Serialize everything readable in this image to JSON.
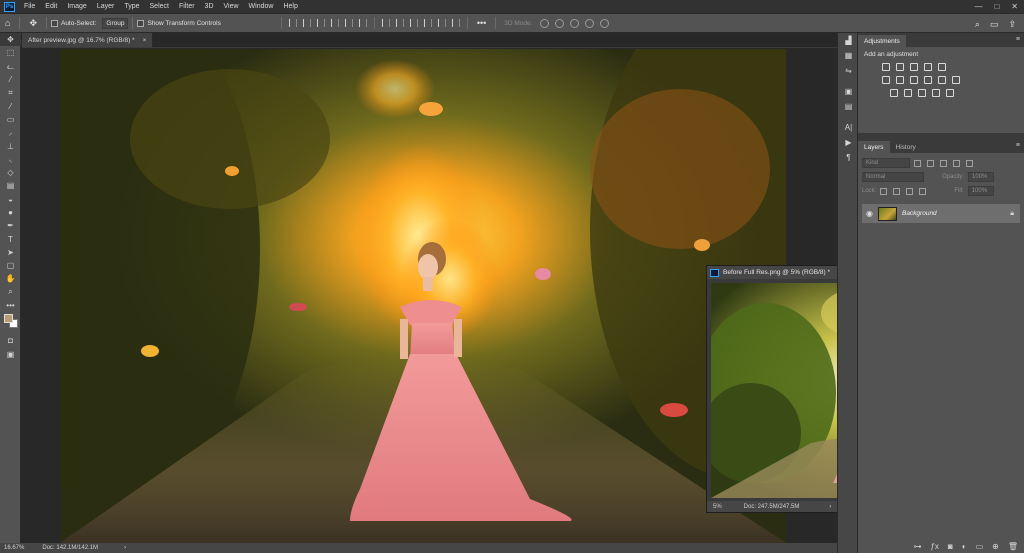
{
  "app": {
    "logo": "Ps",
    "menu": [
      "File",
      "Edit",
      "Image",
      "Layer",
      "Type",
      "Select",
      "Filter",
      "3D",
      "View",
      "Window",
      "Help"
    ],
    "window_controls": [
      "—",
      "□",
      "✕"
    ]
  },
  "options_bar": {
    "home_icon": "home-icon",
    "move_icon": "move-icon",
    "auto_select_label": "Auto-Select:",
    "auto_select_target": "Group",
    "show_transform_label": "Show Transform Controls",
    "mode_3d_label": "3D Mode:",
    "right_icons": [
      "search-icon",
      "workspace-icon",
      "share-icon"
    ]
  },
  "tools": [
    "move",
    "marquee",
    "lasso",
    "quick-select",
    "crop",
    "eyedropper",
    "healing",
    "brush",
    "clone-stamp",
    "history-brush",
    "eraser",
    "gradient",
    "blur",
    "dodge",
    "pen",
    "type",
    "path-select",
    "rectangle",
    "hand",
    "zoom",
    "edit-toolbar"
  ],
  "colors": {
    "foreground": "#b89c74",
    "background": "#ffffff",
    "accent": "#2fa4ff"
  },
  "document": {
    "tab_title": "After preview.jpg @ 16.7% (RGB/8) *",
    "tab_close": "×",
    "zoom": "16.67%",
    "doc_size": "Doc: 142.1M/142.1M",
    "status_arrow": "›"
  },
  "floating_document": {
    "title": "Before Full Res.png @ 5% (RGB/8) *",
    "zoom": "5%",
    "doc_size": "Doc: 247.5M/247.5M",
    "status_arrow": "›"
  },
  "panels": {
    "adjustments": {
      "tab": "Adjustments",
      "heading": "Add an adjustment"
    },
    "layers": {
      "tabs": [
        "Layers",
        "History"
      ],
      "kind_placeholder": "Kind",
      "blend_mode": "Normal",
      "opacity_label": "Opacity:",
      "opacity_value": "100%",
      "lock_label": "Lock:",
      "fill_label": "Fill:",
      "fill_value": "100%",
      "layer_name": "Background"
    }
  }
}
